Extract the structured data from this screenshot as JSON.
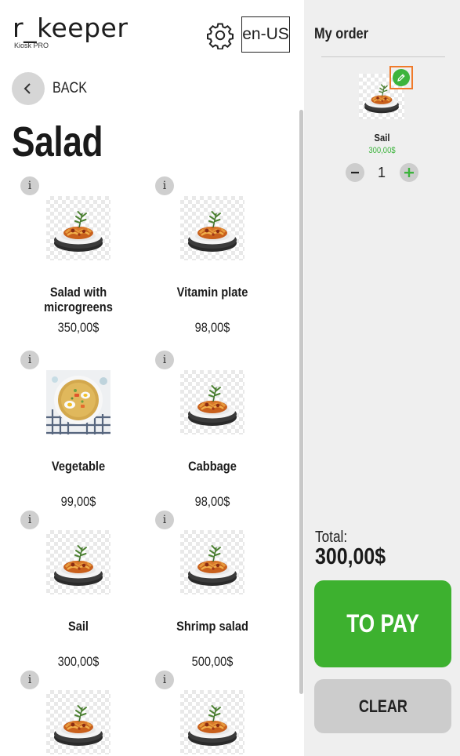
{
  "header": {
    "logo": "r_keeper",
    "logo_sub": "Kiosk PRO",
    "language": "en-US",
    "settings_icon": "gear-icon"
  },
  "nav": {
    "back_label": "BACK",
    "back_icon": "chevron-left-icon"
  },
  "category": {
    "title": "Salad"
  },
  "products": [
    {
      "name": "Salad with microgreens",
      "price": "350,00$",
      "image": "pasta-dish"
    },
    {
      "name": "Vitamin plate",
      "price": "98,00$",
      "image": "pasta-dish"
    },
    {
      "name": "Vegetable",
      "price": "99,00$",
      "image": "soup-bowl"
    },
    {
      "name": "Cabbage",
      "price": "98,00$",
      "image": "pasta-dish"
    },
    {
      "name": "Sail",
      "price": "300,00$",
      "image": "pasta-dish"
    },
    {
      "name": "Shrimp salad",
      "price": "500,00$",
      "image": "pasta-dish"
    },
    {
      "name": "",
      "price": "",
      "image": "pasta-dish"
    },
    {
      "name": "",
      "price": "",
      "image": "pasta-dish"
    }
  ],
  "info_label": "i",
  "order": {
    "title": "My order",
    "items": [
      {
        "name": "Sail",
        "price": "300,00$",
        "quantity": "1"
      }
    ],
    "total_label": "Total:",
    "total_value": "300,00$",
    "pay_label": "TO PAY",
    "clear_label": "CLEAR"
  },
  "colors": {
    "accent_green": "#3db12f",
    "highlight_orange": "#f07a2a",
    "panel_bg": "#efefef",
    "button_gray": "#cccccc"
  }
}
